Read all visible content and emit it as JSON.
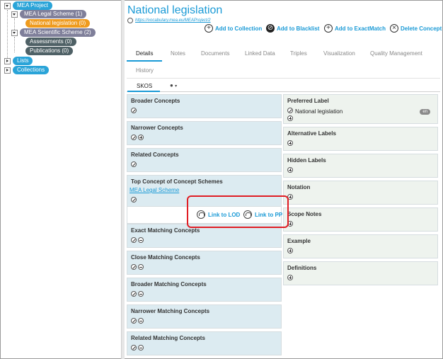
{
  "tree": {
    "project": "MEA Project",
    "legal_scheme": "MEA Legal Scheme (1)",
    "selected_concept": "National legislation (0)",
    "scientific_scheme": "MEA Scientific Scheme (2)",
    "assessments": "Assessments (0)",
    "publications": "Publications (0)",
    "lists": "Lists",
    "collections": "Collections"
  },
  "header": {
    "title": "National legislation",
    "uri": "https://vocabulary.mea.eu/MEAProject/2",
    "actions": [
      {
        "label": "Add to Collection",
        "icon": "plus-circle-icon"
      },
      {
        "label": "Add to Blacklist",
        "icon": "ban-icon"
      },
      {
        "label": "Add to ExactMatch",
        "icon": "plus-circle-icon"
      },
      {
        "label": "Delete Concept",
        "icon": "close-circle-icon"
      }
    ]
  },
  "tabs": [
    "Details",
    "Notes",
    "Documents",
    "Linked Data",
    "Triples",
    "Visualization",
    "Quality Management",
    "History"
  ],
  "active_tab": "Details",
  "subtabs": {
    "skos": "SKOS",
    "person_icon": "person-icon"
  },
  "left_panels": {
    "broader": "Broader Concepts",
    "narrower": "Narrower Concepts",
    "related": "Related Concepts",
    "top_concept": "Top Concept of Concept Schemes",
    "top_concept_link": "MEA Legal Scheme",
    "exact": "Exact Matching Concepts",
    "close": "Close Matching Concepts",
    "broader_match": "Broader Matching Concepts",
    "narrower_match": "Narrower Matching Concepts",
    "related_match": "Related Matching Concepts"
  },
  "popup": {
    "link_lod": "Link to LOD",
    "link_pp": "Link to PP"
  },
  "right_panels": {
    "preferred": "Preferred Label",
    "preferred_value": "National legislation",
    "preferred_lang": "en",
    "alternative": "Alternative Labels",
    "hidden": "Hidden Labels",
    "notation": "Notation",
    "scope": "Scope Notes",
    "example": "Example",
    "definitions": "Definitions"
  },
  "colors": {
    "accent": "#1a9ad6",
    "selected": "#ef9b1e",
    "highlight": "#e01d24"
  }
}
